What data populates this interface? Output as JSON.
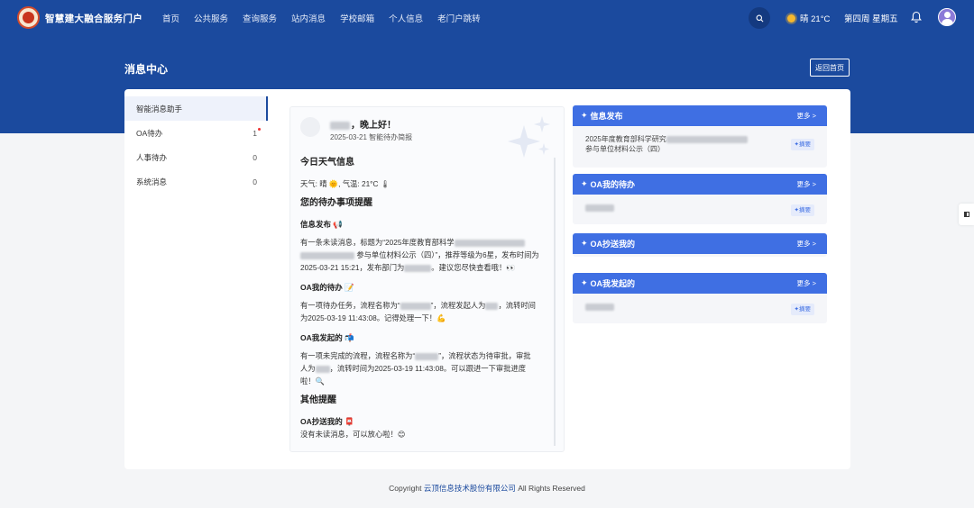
{
  "header": {
    "brand": "智慧建大融合服务门户",
    "nav": [
      "首页",
      "公共服务",
      "查询服务",
      "站内消息",
      "学校邮箱",
      "个人信息",
      "老门户跳转"
    ],
    "weather": "晴 21°C",
    "week": "第四周 星期五"
  },
  "page": {
    "title": "消息中心",
    "back_label": "返回首页"
  },
  "sidebar": {
    "items": [
      {
        "label": "智能消息助手",
        "count": ""
      },
      {
        "label": "OA待办",
        "count": "1"
      },
      {
        "label": "人事待办",
        "count": "0"
      },
      {
        "label": "系统消息",
        "count": "0"
      }
    ]
  },
  "report": {
    "greeting": "，晚上好！",
    "date_line": "2025-03-21 智能待办简报",
    "weather_title": "今日天气信息",
    "weather_line": "天气: 晴 🌞, 气温: 21°C 🌡",
    "reminder_title": "您的待办事项提醒",
    "info_title": "信息发布 📢",
    "info_p1": "有一条未读消息，标题为“2025年度教育部科学",
    "info_p2": "参与单位材料公示（四）”，推荐等级为6星，发布时间为",
    "info_p3": "2025-03-21 15:21，发布部门为",
    "info_p4": "。建议您尽快查看哦！👀",
    "oa_todo_title": "OA我的待办 📝",
    "oa_todo_p1": "有一项待办任务，流程名称为“",
    "oa_todo_p2": "”，流程发起人为",
    "oa_todo_p3": "，流转时间",
    "oa_todo_p4": "为2025-03-19 11:43:08。记得处理一下！💪",
    "oa_init_title": "OA我发起的 📬",
    "oa_init_p1": "有一项未完成的流程，流程名称为“",
    "oa_init_p2": "”，流程状态为待审批，审批",
    "oa_init_p3": "人为",
    "oa_init_p4": "，流转时间为2025-03-19 11:43:08。可以跟进一下审批进度",
    "oa_init_p5": "啦！🔍",
    "other_title": "其他提醒",
    "cc_title": "OA抄送我的 📮",
    "cc_line": "没有未读消息，可以放心啦！😊"
  },
  "widgets": [
    {
      "title": "信息发布",
      "more": "更多 >",
      "row_line1": "2025年度教育部科学研究",
      "row_line2": "参与单位材料公示（四）",
      "badge": "✦摘要"
    },
    {
      "title": "OA我的待办",
      "more": "更多 >",
      "badge": "✦摘要"
    },
    {
      "title": "OA抄送我的",
      "more": "更多 >"
    },
    {
      "title": "OA我发起的",
      "more": "更多 >",
      "badge": "✦摘要"
    }
  ],
  "footer": {
    "prefix": "Copyright ",
    "company": "云顶信息技术股份有限公司",
    "suffix": " All Rights Reserved"
  },
  "colors": {
    "primary": "#1b4a9e",
    "accent": "#3f6fe3"
  }
}
